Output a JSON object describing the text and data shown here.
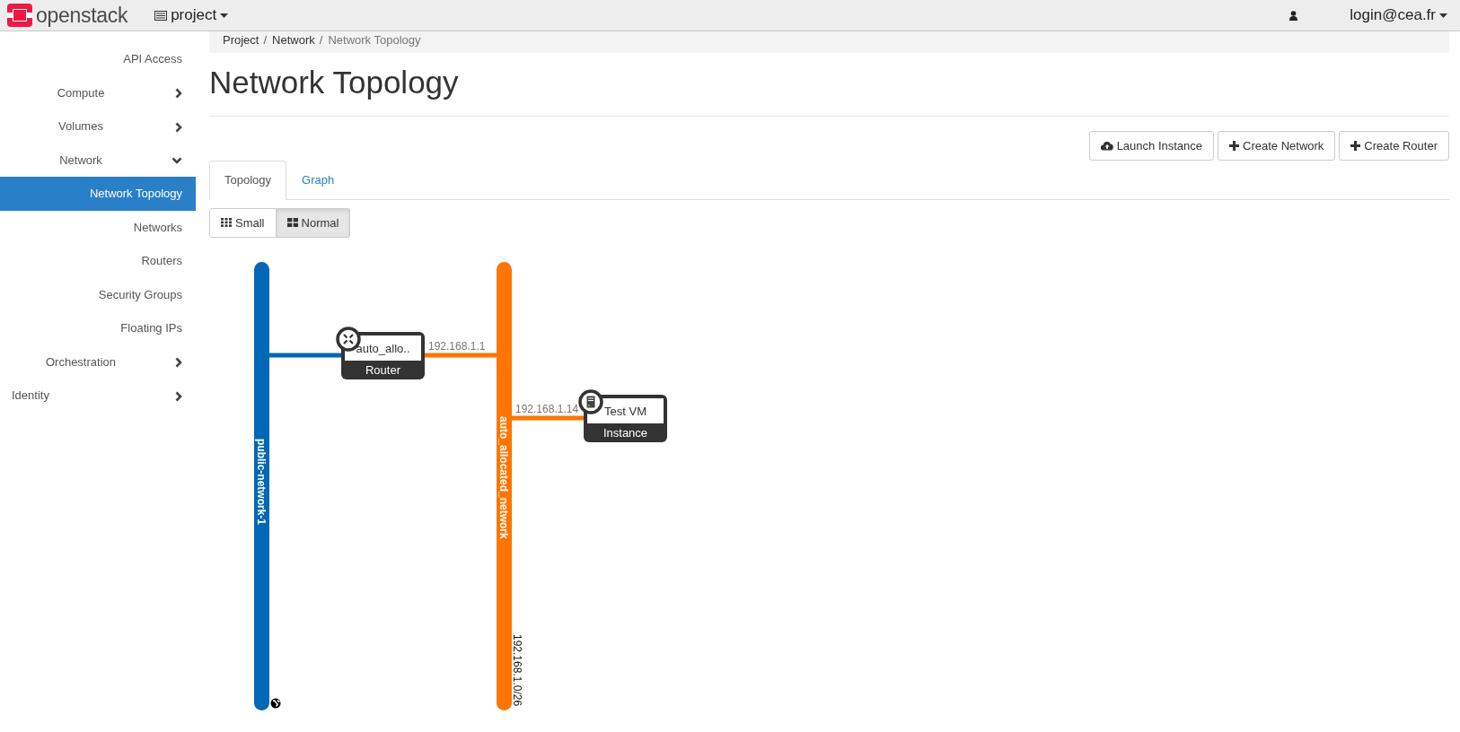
{
  "brand": {
    "name": "openstack"
  },
  "project_menu": {
    "label": "project"
  },
  "user_menu": {
    "label": "login@cea.fr"
  },
  "sidebar": {
    "items": [
      {
        "label": "API Access",
        "kind": "panel",
        "selected": false
      },
      {
        "label": "Compute",
        "kind": "group",
        "expanded": false
      },
      {
        "label": "Volumes",
        "kind": "group",
        "expanded": false
      },
      {
        "label": "Network",
        "kind": "group",
        "expanded": true
      },
      {
        "label": "Network Topology",
        "kind": "panel",
        "selected": true
      },
      {
        "label": "Networks",
        "kind": "panel",
        "selected": false
      },
      {
        "label": "Routers",
        "kind": "panel",
        "selected": false
      },
      {
        "label": "Security Groups",
        "kind": "panel",
        "selected": false
      },
      {
        "label": "Floating IPs",
        "kind": "panel",
        "selected": false
      },
      {
        "label": "Orchestration",
        "kind": "group",
        "expanded": false
      },
      {
        "label": "Identity",
        "kind": "section",
        "expanded": false
      }
    ]
  },
  "breadcrumb": [
    {
      "label": "Project",
      "separator": "/"
    },
    {
      "label": "Network",
      "separator": "/"
    },
    {
      "label": "Network Topology"
    }
  ],
  "title": "Network Topology",
  "actions": [
    {
      "label": "Launch Instance",
      "kind": "launch"
    },
    {
      "label": "Create Network",
      "kind": "create"
    },
    {
      "label": "Create Router",
      "kind": "create"
    }
  ],
  "tabs": [
    {
      "label": "Topology",
      "selected": true
    },
    {
      "label": "Graph",
      "selected": false
    }
  ],
  "size_toggle": [
    {
      "label": "Small",
      "kind": "small",
      "selected": false
    },
    {
      "label": "Normal",
      "kind": "normal",
      "selected": true
    }
  ],
  "topology": {
    "networks": [
      {
        "name": "public-network-1",
        "color": "#0068b4",
        "kind": "external"
      },
      {
        "name": "auto_allocated_network",
        "color": "#ff7500",
        "kind": "internal",
        "subnet": "192.168.1.0/26"
      }
    ],
    "nodes": [
      {
        "name": "auto_allo..",
        "type": "Router",
        "kind": "router",
        "address": "192.168.1.1"
      },
      {
        "name": "Test VM",
        "type": "Instance",
        "kind": "instance",
        "address": "192.168.1.14"
      }
    ]
  }
}
